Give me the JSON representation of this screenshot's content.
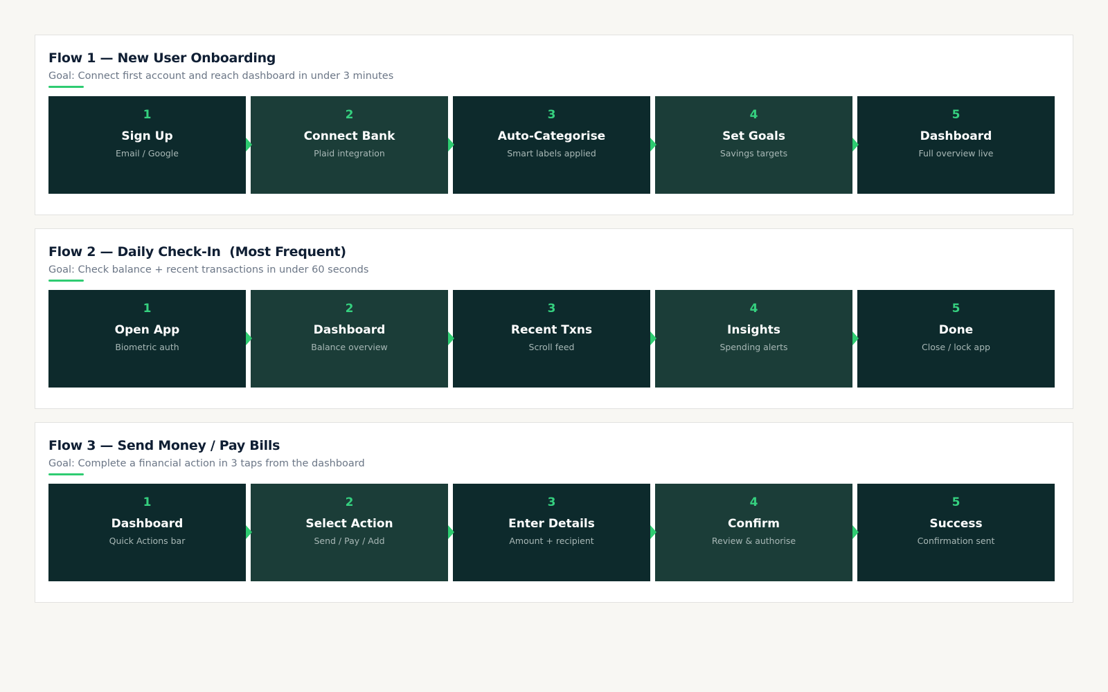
{
  "colors": {
    "page_bg": "#f8f7f3",
    "card_bg": "#ffffff",
    "step_dark": "#0d2a2c",
    "step_mid": "#1b3d38",
    "accent_green": "#2ecc71",
    "title_navy": "#0f1e33",
    "goal_gray": "#6b7686"
  },
  "flows": [
    {
      "title": "Flow 1 — New User Onboarding",
      "goal": "Goal: Connect first account and reach dashboard in under 3 minutes",
      "steps": [
        {
          "num": "1",
          "title": "Sign Up",
          "sub": "Email / Google"
        },
        {
          "num": "2",
          "title": "Connect Bank",
          "sub": "Plaid integration"
        },
        {
          "num": "3",
          "title": "Auto-Categorise",
          "sub": "Smart labels applied"
        },
        {
          "num": "4",
          "title": "Set Goals",
          "sub": "Savings targets"
        },
        {
          "num": "5",
          "title": "Dashboard",
          "sub": "Full overview live"
        }
      ]
    },
    {
      "title": "Flow 2 — Daily Check-In  (Most Frequent)",
      "goal": "Goal: Check balance + recent transactions in under 60 seconds",
      "steps": [
        {
          "num": "1",
          "title": "Open App",
          "sub": "Biometric auth"
        },
        {
          "num": "2",
          "title": "Dashboard",
          "sub": "Balance overview"
        },
        {
          "num": "3",
          "title": "Recent Txns",
          "sub": "Scroll feed"
        },
        {
          "num": "4",
          "title": "Insights",
          "sub": "Spending alerts"
        },
        {
          "num": "5",
          "title": "Done",
          "sub": "Close / lock app"
        }
      ]
    },
    {
      "title": "Flow 3 — Send Money / Pay Bills",
      "goal": "Goal: Complete a financial action in 3 taps from the dashboard",
      "steps": [
        {
          "num": "1",
          "title": "Dashboard",
          "sub": "Quick Actions bar"
        },
        {
          "num": "2",
          "title": "Select Action",
          "sub": "Send / Pay / Add"
        },
        {
          "num": "3",
          "title": "Enter Details",
          "sub": "Amount + recipient"
        },
        {
          "num": "4",
          "title": "Confirm",
          "sub": "Review & authorise"
        },
        {
          "num": "5",
          "title": "Success",
          "sub": "Confirmation sent"
        }
      ]
    }
  ]
}
